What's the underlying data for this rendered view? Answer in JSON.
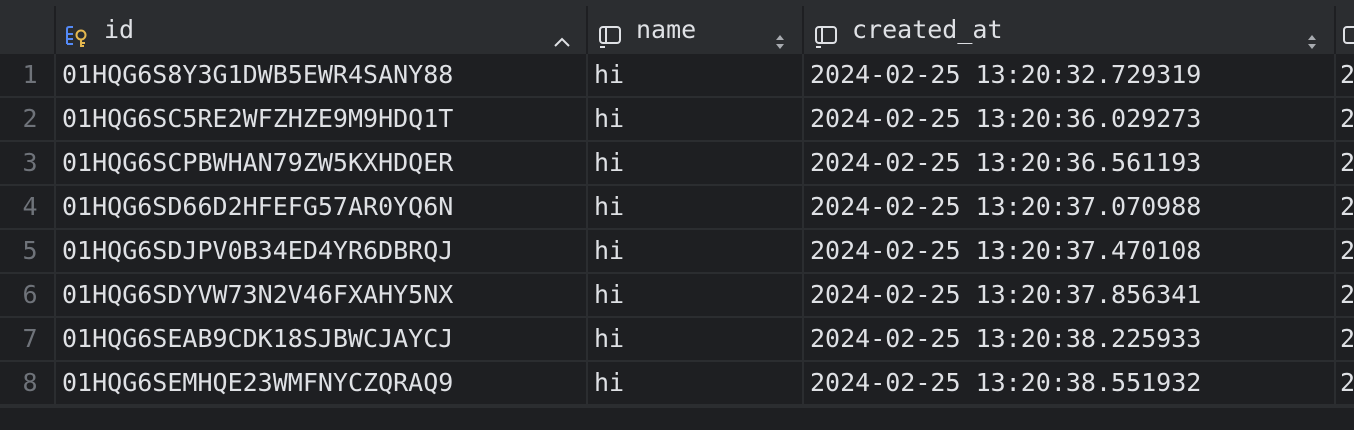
{
  "columns": [
    {
      "name": "id",
      "icon": "primary-key-column-icon",
      "sort": "ascending"
    },
    {
      "name": "name",
      "icon": "column-icon",
      "sort": "none"
    },
    {
      "name": "created_at",
      "icon": "column-icon",
      "sort": "none"
    }
  ],
  "rows": [
    {
      "num": "1",
      "id": "01HQG6S8Y3G1DWB5EWR4SANY88",
      "name": "hi",
      "created_at": "2024-02-25 13:20:32.729319",
      "next": "2"
    },
    {
      "num": "2",
      "id": "01HQG6SC5RE2WFZHZE9M9HDQ1T",
      "name": "hi",
      "created_at": "2024-02-25 13:20:36.029273",
      "next": "2"
    },
    {
      "num": "3",
      "id": "01HQG6SCPBWHAN79ZW5KXHDQER",
      "name": "hi",
      "created_at": "2024-02-25 13:20:36.561193",
      "next": "2"
    },
    {
      "num": "4",
      "id": "01HQG6SD66D2HFEFG57AR0YQ6N",
      "name": "hi",
      "created_at": "2024-02-25 13:20:37.070988",
      "next": "2"
    },
    {
      "num": "5",
      "id": "01HQG6SDJPV0B34ED4YR6DBRQJ",
      "name": "hi",
      "created_at": "2024-02-25 13:20:37.470108",
      "next": "2"
    },
    {
      "num": "6",
      "id": "01HQG6SDYVW73N2V46FXAHY5NX",
      "name": "hi",
      "created_at": "2024-02-25 13:20:37.856341",
      "next": "2"
    },
    {
      "num": "7",
      "id": "01HQG6SEAB9CDK18SJBWCJAYCJ",
      "name": "hi",
      "created_at": "2024-02-25 13:20:38.225933",
      "next": "2"
    },
    {
      "num": "8",
      "id": "01HQG6SEMHQE23WMFNYCZQRAQ9",
      "name": "hi",
      "created_at": "2024-02-25 13:20:38.551932",
      "next": "2"
    }
  ],
  "colors": {
    "background": "#1e1f22",
    "header_background": "#2b2d30",
    "text": "#dfe1e5",
    "row_number": "#6f737a",
    "key_icon_blue": "#548af7",
    "key_icon_gold": "#e5b84f"
  }
}
